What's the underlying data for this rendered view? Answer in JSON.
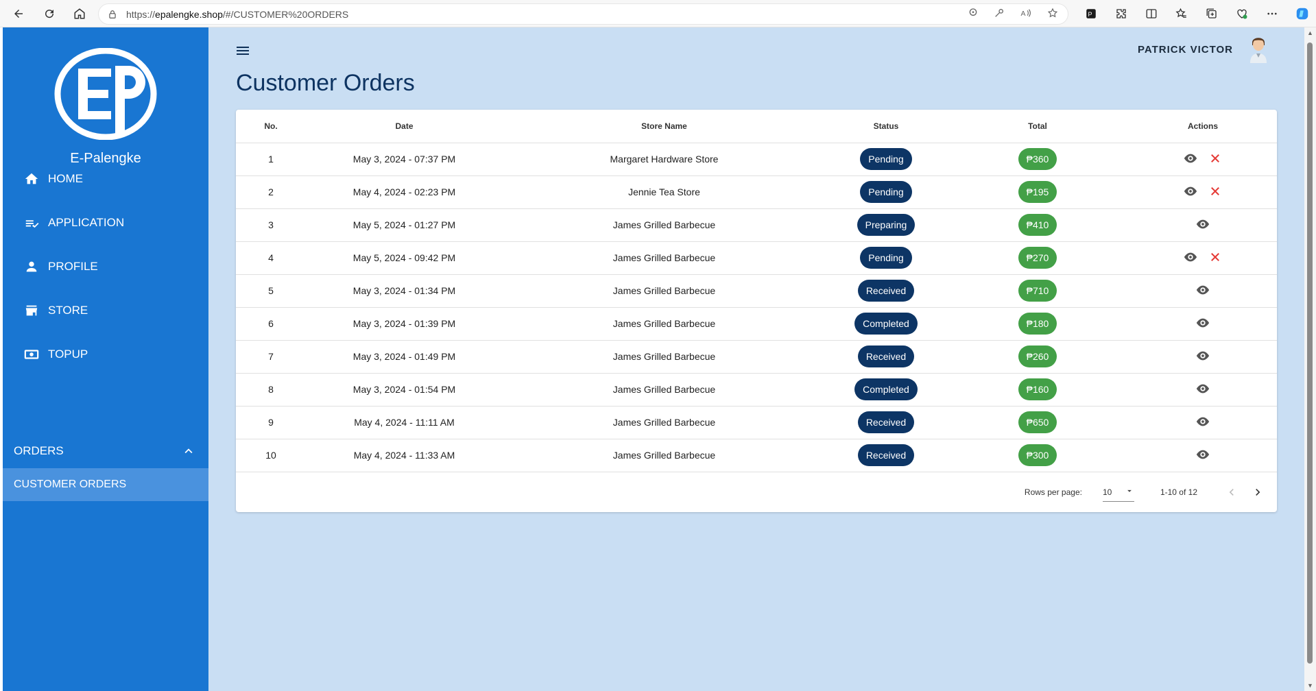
{
  "browser": {
    "url_prefix": "https://",
    "url_host": "epalengke.shop",
    "url_path": "/#/CUSTOMER%20ORDERS"
  },
  "sidebar": {
    "brand": "E-Palengke",
    "items": [
      {
        "label": "HOME",
        "icon": "home-icon"
      },
      {
        "label": "APPLICATION",
        "icon": "playlist-check-icon"
      },
      {
        "label": "PROFILE",
        "icon": "person-icon"
      },
      {
        "label": "STORE",
        "icon": "store-icon"
      },
      {
        "label": "TOPUP",
        "icon": "cash-icon"
      }
    ],
    "orders_group": "ORDERS",
    "sub_items": [
      {
        "label": "CUSTOMER ORDERS"
      }
    ]
  },
  "header": {
    "user_name": "PATRICK VICTOR"
  },
  "page": {
    "title": "Customer Orders"
  },
  "table": {
    "columns": [
      "No.",
      "Date",
      "Store Name",
      "Status",
      "Total",
      "Actions"
    ],
    "rows": [
      {
        "no": "1",
        "date": "May 3, 2024 - 07:37 PM",
        "store": "Margaret Hardware Store",
        "status": "Pending",
        "total": "₱360",
        "cancel": true
      },
      {
        "no": "2",
        "date": "May 4, 2024 - 02:23 PM",
        "store": "Jennie Tea Store",
        "status": "Pending",
        "total": "₱195",
        "cancel": true
      },
      {
        "no": "3",
        "date": "May 5, 2024 - 01:27 PM",
        "store": "James Grilled Barbecue",
        "status": "Preparing",
        "total": "₱410",
        "cancel": false
      },
      {
        "no": "4",
        "date": "May 5, 2024 - 09:42 PM",
        "store": "James Grilled Barbecue",
        "status": "Pending",
        "total": "₱270",
        "cancel": true
      },
      {
        "no": "5",
        "date": "May 3, 2024 - 01:34 PM",
        "store": "James Grilled Barbecue",
        "status": "Received",
        "total": "₱710",
        "cancel": false
      },
      {
        "no": "6",
        "date": "May 3, 2024 - 01:39 PM",
        "store": "James Grilled Barbecue",
        "status": "Completed",
        "total": "₱180",
        "cancel": false
      },
      {
        "no": "7",
        "date": "May 3, 2024 - 01:49 PM",
        "store": "James Grilled Barbecue",
        "status": "Received",
        "total": "₱260",
        "cancel": false
      },
      {
        "no": "8",
        "date": "May 3, 2024 - 01:54 PM",
        "store": "James Grilled Barbecue",
        "status": "Completed",
        "total": "₱160",
        "cancel": false
      },
      {
        "no": "9",
        "date": "May 4, 2024 - 11:11 AM",
        "store": "James Grilled Barbecue",
        "status": "Received",
        "total": "₱650",
        "cancel": false
      },
      {
        "no": "10",
        "date": "May 4, 2024 - 11:33 AM",
        "store": "James Grilled Barbecue",
        "status": "Received",
        "total": "₱300",
        "cancel": false
      }
    ]
  },
  "pagination": {
    "rows_per_page_label": "Rows per page:",
    "rows_per_page": "10",
    "range": "1-10 of 12"
  },
  "colors": {
    "sidebar": "#1976d2",
    "background": "#c9def3",
    "status_pill": "#0d3565",
    "total_pill": "#43a047",
    "cancel": "#e53935"
  }
}
